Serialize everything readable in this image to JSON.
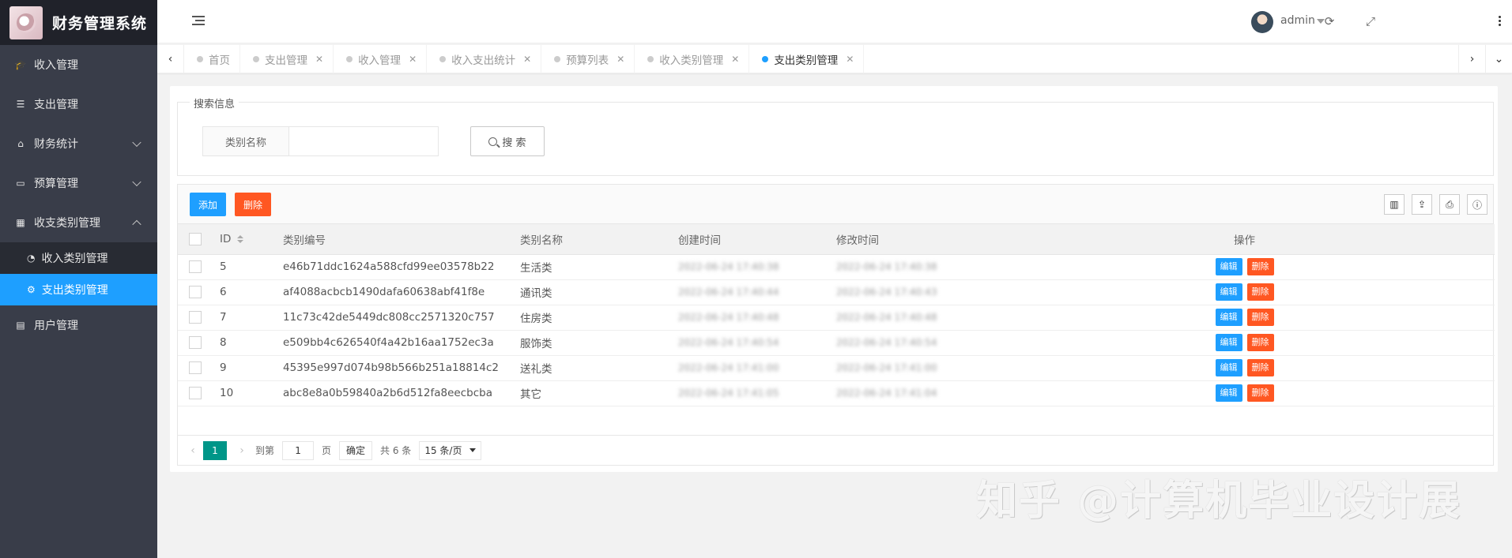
{
  "app": {
    "title": "财务管理系统"
  },
  "sidebar": {
    "items": [
      {
        "label": "收入管理",
        "icon": "graduation-cap-icon"
      },
      {
        "label": "支出管理",
        "icon": "list-icon"
      },
      {
        "label": "财务统计",
        "icon": "home-icon"
      },
      {
        "label": "预算管理",
        "icon": "window-icon"
      },
      {
        "label": "收支类别管理",
        "icon": "calendar-icon"
      },
      {
        "label": "用户管理",
        "icon": "table-icon"
      }
    ],
    "subitems": [
      {
        "label": "收入类别管理",
        "icon": "dashboard-icon"
      },
      {
        "label": "支出类别管理",
        "icon": "gears-icon"
      }
    ]
  },
  "header": {
    "user": "admin"
  },
  "tabs": [
    {
      "label": "首页"
    },
    {
      "label": "支出管理"
    },
    {
      "label": "收入管理"
    },
    {
      "label": "收入支出统计"
    },
    {
      "label": "预算列表"
    },
    {
      "label": "收入类别管理"
    },
    {
      "label": "支出类别管理"
    }
  ],
  "search": {
    "legend": "搜索信息",
    "label": "类别名称",
    "value": "",
    "placeholder": "",
    "button": "搜 索"
  },
  "toolbar": {
    "add": "添加",
    "delete": "删除"
  },
  "table": {
    "columns": [
      "ID",
      "类别编号",
      "类别名称",
      "创建时间",
      "修改时间",
      "操作"
    ],
    "rows": [
      {
        "id": "5",
        "code": "e46b71ddc1624a588cfd99ee03578b22",
        "name": "生活类",
        "created": "2022-06-24 17:40:38",
        "modified": "2022-06-24 17:40:38"
      },
      {
        "id": "6",
        "code": "af4088acbcb1490dafa60638abf41f8e",
        "name": "通讯类",
        "created": "2022-06-24 17:40:44",
        "modified": "2022-06-24 17:40:43"
      },
      {
        "id": "7",
        "code": "11c73c42de5449dc808cc2571320c757",
        "name": "住房类",
        "created": "2022-06-24 17:40:48",
        "modified": "2022-06-24 17:40:48"
      },
      {
        "id": "8",
        "code": "e509bb4c626540f4a42b16aa1752ec3a",
        "name": "服饰类",
        "created": "2022-06-24 17:40:54",
        "modified": "2022-06-24 17:40:54"
      },
      {
        "id": "9",
        "code": "45395e997d074b98b566b251a18814c2",
        "name": "送礼类",
        "created": "2022-06-24 17:41:00",
        "modified": "2022-06-24 17:41:00"
      },
      {
        "id": "10",
        "code": "abc8e8a0b59840a2b6d512fa8eecbcba",
        "name": "其它",
        "created": "2022-06-24 17:41:05",
        "modified": "2022-06-24 17:41:04"
      }
    ],
    "edit_label": "编辑",
    "delete_label": "删除"
  },
  "pager": {
    "current": "1",
    "goto_label": "到第",
    "goto_value": "1",
    "page_unit": "页",
    "confirm": "确定",
    "total": "共 6 条",
    "page_size": "15 条/页"
  },
  "watermark": "知乎 @计算机毕业设计展",
  "colors": {
    "accent": "#1e9fff",
    "danger": "#ff5722",
    "pager": "#009688",
    "sidebar": "#393d49"
  }
}
